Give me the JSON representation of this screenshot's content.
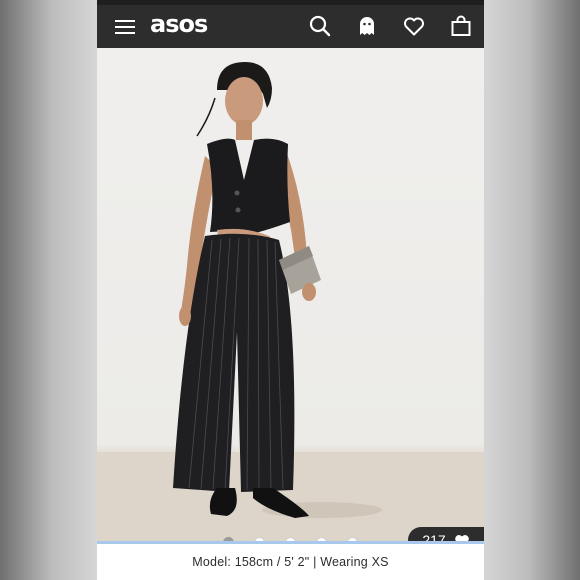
{
  "header": {
    "logo_text": "asos",
    "icons": [
      "menu-icon",
      "search-icon",
      "account-icon",
      "heart-icon",
      "bag-icon"
    ]
  },
  "product_image": {
    "description_icon": "product-photo",
    "carousel": {
      "total": 5,
      "active_index": 0
    }
  },
  "likes": {
    "count": "217",
    "icon": "heart-icon"
  },
  "caption": {
    "text": "Model: 158cm / 5' 2\" | Wearing XS"
  },
  "colors": {
    "header_bg": "#2d2d2d",
    "accent_line": "#a8c8ec",
    "photo_bg": "#eeede9"
  }
}
